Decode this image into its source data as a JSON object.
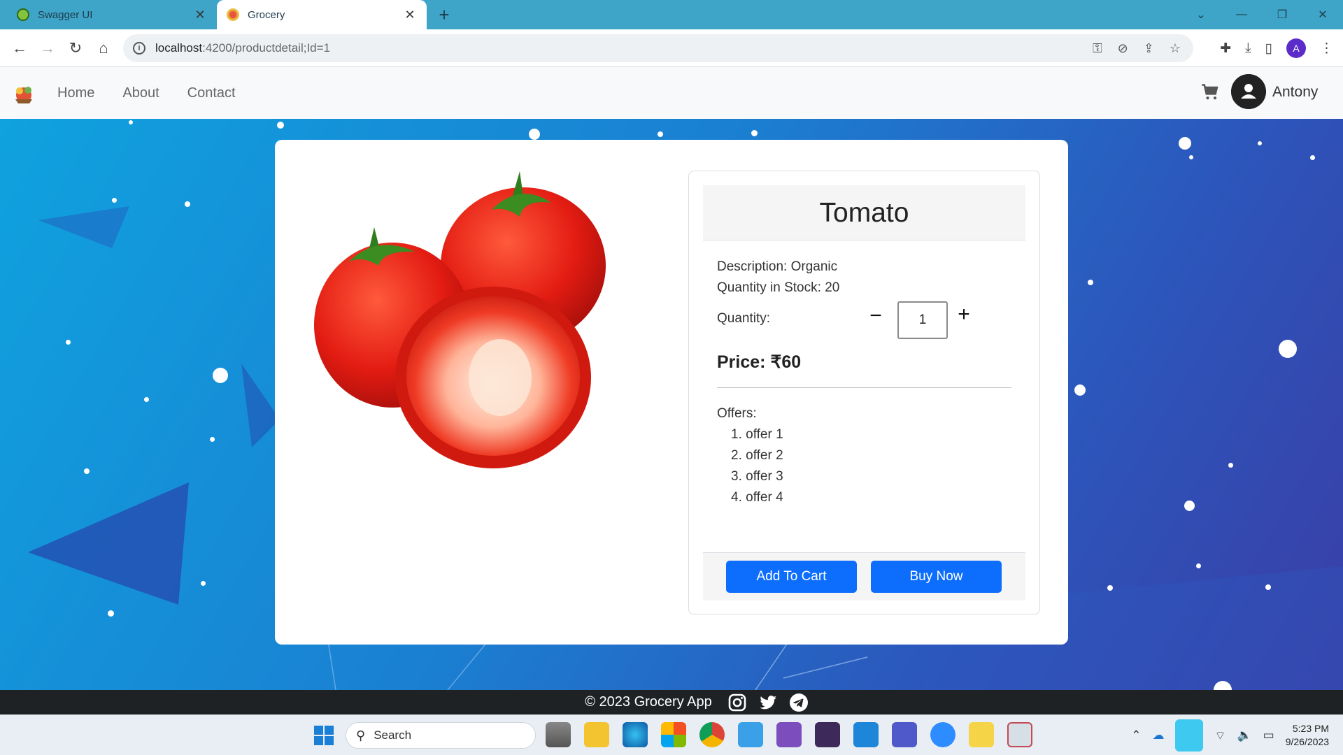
{
  "browser": {
    "tabs": [
      {
        "title": "Swagger UI",
        "active": false
      },
      {
        "title": "Grocery",
        "active": true
      }
    ],
    "url_host": "localhost",
    "url_path": ":4200/productdetail;Id=1"
  },
  "nav": {
    "links": [
      "Home",
      "About",
      "Contact"
    ],
    "user_name": "Antony"
  },
  "product": {
    "name": "Tomato",
    "description_label": "Description: ",
    "description": "Organic",
    "stock_label": "Quantity in Stock: ",
    "stock": "20",
    "quantity_label": "Quantity:",
    "quantity": "1",
    "price_label": "Price: ",
    "price": "₹60",
    "offers_heading": "Offers:",
    "offers": [
      "1. offer 1",
      "2. offer 2",
      "3. offer 3",
      "4. offer 4"
    ],
    "add_to_cart_label": "Add To Cart",
    "buy_now_label": "Buy Now"
  },
  "footer": {
    "text": "© 2023 Grocery App"
  },
  "taskbar": {
    "search_placeholder": "Search",
    "time": "5:23 PM",
    "date": "9/26/2023"
  },
  "colors": {
    "primary_button": "#0d6efd",
    "background_gradient_start": "#0fa2df",
    "background_gradient_end": "#3a3ea7",
    "tabbar": "#3ea4c8"
  }
}
